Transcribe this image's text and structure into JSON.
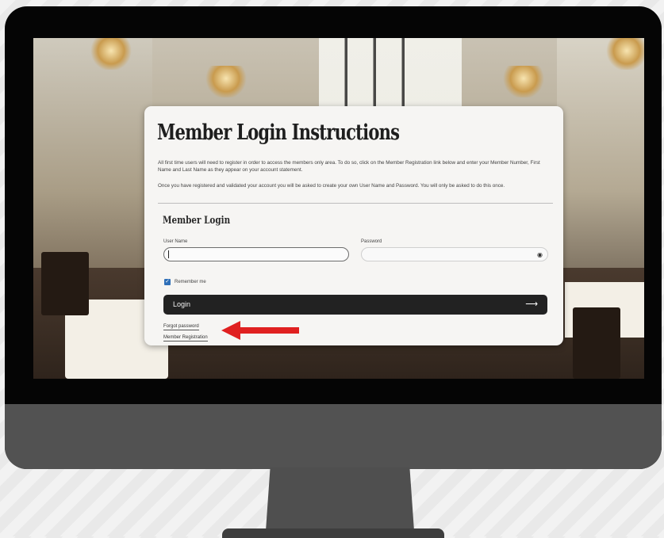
{
  "page": {
    "title": "Member Login Instructions",
    "intro_1": "All first time users will need to register in order to access the members only area. To do so, click on the Member Registration link below and enter your Member Number, First Name and Last Name as they appear on your account statement.",
    "intro_2": "Once you have registered and validated your account you will be asked to create your own User Name and Password. You will only be asked to do this once."
  },
  "login": {
    "heading": "Member Login",
    "username_label": "User Name",
    "username_value": "",
    "password_label": "Password",
    "password_value": "",
    "remember_label": "Remember me",
    "remember_checked": true,
    "button_label": "Login",
    "forgot_link": "Forgot password",
    "register_link": "Member Registration"
  },
  "icons": {
    "password_toggle": "eye-icon",
    "login_arrow": "arrow-right-icon",
    "annotation": "red-arrow-icon"
  },
  "colors": {
    "button": "#222222",
    "checkbox": "#2f6fb8",
    "annotation_arrow": "#e02020",
    "monitor_frame": "#050505",
    "monitor_chin": "#525252"
  }
}
